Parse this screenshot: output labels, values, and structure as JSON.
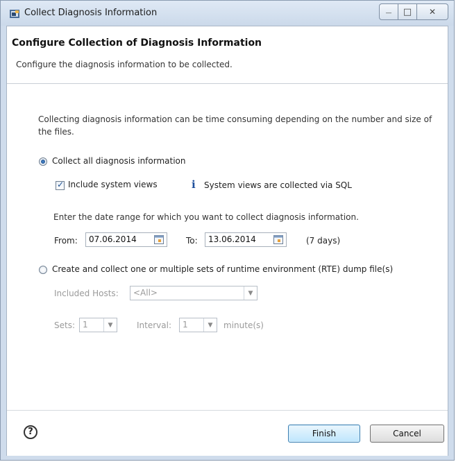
{
  "window": {
    "title": "Collect Diagnosis Information",
    "controls": {
      "minimize": "—",
      "maximize": "□",
      "close": "✕"
    }
  },
  "header": {
    "title": "Configure Collection of Diagnosis Information",
    "description": "Configure the diagnosis information to be collected."
  },
  "content": {
    "info_text": "Collecting diagnosis information can be time consuming depending on the number and size of the files.",
    "option_all": {
      "label": "Collect all diagnosis information",
      "selected": true,
      "include_system_views": {
        "label": "Include system views",
        "checked": true
      },
      "info_icon": "i",
      "info_note": "System views are collected via SQL",
      "date_range_prompt": "Enter the date range for which you want to collect diagnosis information.",
      "from_label": "From:",
      "from_value": "07.06.2014",
      "to_label": "To:",
      "to_value": "13.06.2014",
      "days_note": "(7 days)"
    },
    "option_rte": {
      "label": "Create and collect one or multiple sets of runtime environment (RTE) dump file(s)",
      "selected": false,
      "hosts_label": "Included Hosts:",
      "hosts_value": "<All>",
      "sets_label": "Sets:",
      "sets_value": "1",
      "interval_label": "Interval:",
      "interval_value": "1",
      "interval_unit": "minute(s)"
    }
  },
  "footer": {
    "help_icon": "?",
    "finish_label": "Finish",
    "cancel_label": "Cancel"
  },
  "icons": {
    "app": "app-window-icon",
    "calendar": "calendar-icon",
    "help": "help-icon",
    "info": "info-icon"
  },
  "colors": {
    "accent_blue": "#1e4f9b",
    "window_frame": "#cfdcec",
    "finish_border": "#3c7fb1"
  }
}
